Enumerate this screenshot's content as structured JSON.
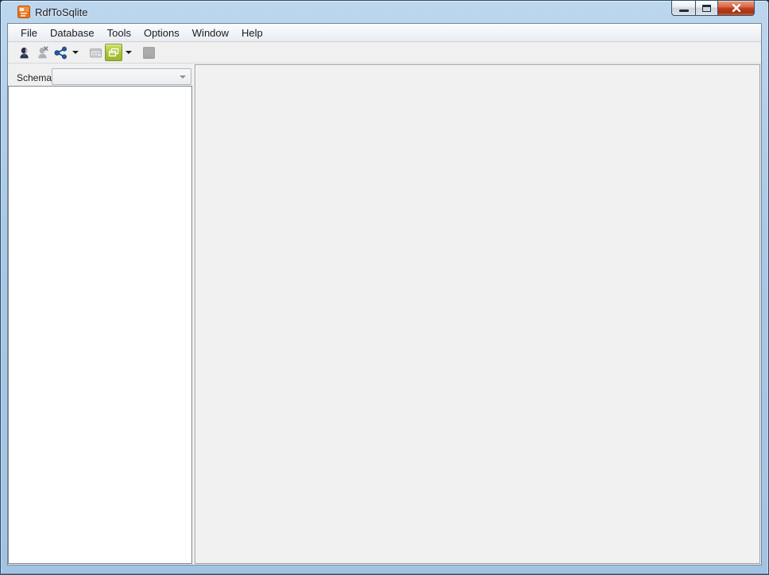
{
  "window": {
    "title": "RdfToSqlite"
  },
  "menubar": {
    "items": [
      "File",
      "Database",
      "Tools",
      "Options",
      "Window",
      "Help"
    ]
  },
  "toolbar": {
    "buttons": [
      {
        "name": "connect-user",
        "icon": "user-icon",
        "enabled": true
      },
      {
        "name": "disconnect-user",
        "icon": "user-x-icon",
        "enabled": false
      },
      {
        "name": "share-connection",
        "icon": "share-icon",
        "enabled": true
      },
      {
        "name": "share-connection-dropdown",
        "icon": "dropdown-arrow-icon",
        "enabled": true
      },
      {
        "name": "query-window",
        "icon": "query-grid-icon",
        "enabled": false
      },
      {
        "name": "window-layout",
        "icon": "window-green-icon",
        "enabled": true,
        "active": true
      },
      {
        "name": "window-layout-dropdown",
        "icon": "dropdown-arrow-icon",
        "enabled": true
      },
      {
        "name": "stop",
        "icon": "stop-icon",
        "enabled": false
      }
    ]
  },
  "sidebar": {
    "schema_label": "Schema",
    "schema_combo_value": ""
  },
  "colors": {
    "titlebar_top": "#bdd6ee",
    "titlebar_bottom": "#a2c4e2",
    "close_button_red": "#bf3b1e",
    "toolbar_active_green": "#a9c23a",
    "share_icon_blue": "#1f4e8f",
    "app_icon_orange": "#e8731f",
    "client_bg": "#f0f0f0",
    "tree_panel_bg": "#ffffff"
  }
}
